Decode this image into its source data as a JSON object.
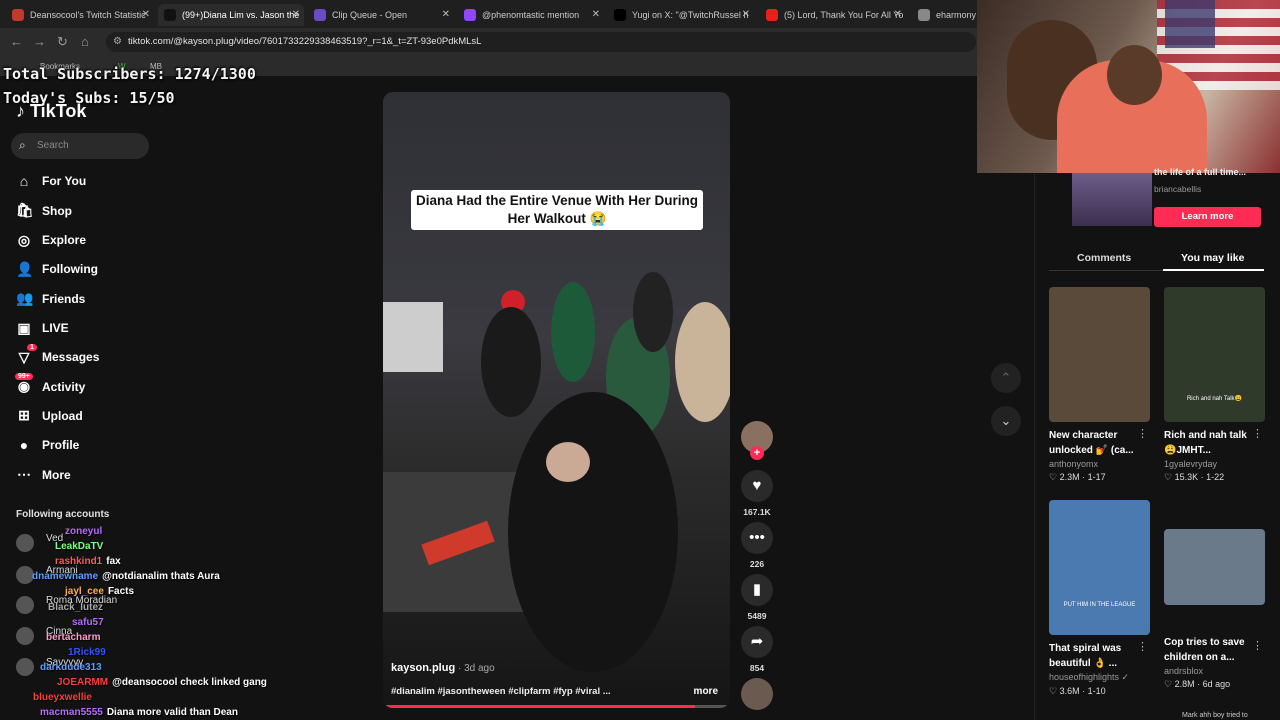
{
  "browser": {
    "tabs": [
      {
        "label": "Deansocool's Twitch Statistic",
        "color": "#c0392b"
      },
      {
        "label": "(99+)Diana Lim vs. Jason the",
        "color": "#111111",
        "active": true
      },
      {
        "label": "Clip Queue - Open",
        "color": "#6a4bc4"
      },
      {
        "label": "@phenomtastic mention",
        "color": "#9146ff"
      },
      {
        "label": "Yugi on X: \"@TwitchRussel h",
        "color": "#000000"
      },
      {
        "label": "(5) Lord, Thank You For All Yo",
        "color": "#e62117"
      },
      {
        "label": "eharmony -",
        "color": "#888888"
      }
    ],
    "url": "tiktok.com/@kayson.plug/video/7601733229338463519?_r=1&_t=ZT-93e0PdkMLsL",
    "bookmarks": [
      "Bookmarks",
      "W",
      "MB"
    ]
  },
  "overlay": {
    "subscribers": "Total Subscribers: 1274/1300",
    "today_subs": "Today's Subs: 15/50"
  },
  "tiktok": {
    "logo": "TikTok",
    "search_placeholder": "Search",
    "nav": [
      {
        "label": "For You",
        "icon": "home-icon"
      },
      {
        "label": "Shop",
        "icon": "shop-icon"
      },
      {
        "label": "Explore",
        "icon": "explore-icon"
      },
      {
        "label": "Following",
        "icon": "following-icon"
      },
      {
        "label": "Friends",
        "icon": "friends-icon"
      },
      {
        "label": "LIVE",
        "icon": "live-icon"
      },
      {
        "label": "Messages",
        "icon": "messages-icon",
        "badge": "1"
      },
      {
        "label": "Activity",
        "icon": "activity-icon",
        "badge": "99+"
      },
      {
        "label": "Upload",
        "icon": "upload-icon"
      },
      {
        "label": "Profile",
        "icon": "profile-icon"
      },
      {
        "label": "More",
        "icon": "more-icon"
      }
    ],
    "following_title": "Following accounts",
    "following_accounts": [
      "Ved",
      "Armani",
      "Roma Moradian",
      "Cinna",
      "Savvyyy"
    ]
  },
  "chat": [
    {
      "user": "zoneyul",
      "msg": "",
      "color": "#b56cff"
    },
    {
      "user": "LeakDaTV",
      "msg": "",
      "color": "#7fff7f"
    },
    {
      "user": "rashkind1",
      "msg": "fax",
      "color": "#ff5a5a"
    },
    {
      "user": "dnamewname",
      "msg": "@notdianalim thats Aura",
      "color": "#5aa0ff"
    },
    {
      "user": "jayl_cee",
      "msg": "Facts",
      "color": "#ffb347"
    },
    {
      "user": "Black_lutez",
      "msg": "",
      "color": "#aaaaaa"
    },
    {
      "user": "safu57",
      "msg": "",
      "color": "#b56cff"
    },
    {
      "user": "bertacharm",
      "msg": "",
      "color": "#ff9acb"
    },
    {
      "user": "1Rick99",
      "msg": "",
      "color": "#3355ff"
    },
    {
      "user": "darkdude313",
      "msg": "",
      "color": "#5aa0ff"
    },
    {
      "user": "JOEARMM",
      "msg": "@deansocool check linked gang",
      "color": "#ff3b3b"
    },
    {
      "user": "blueyxwellie",
      "msg": "",
      "color": "#ff3b3b"
    },
    {
      "user": "macman5555",
      "msg": "Diana more valid than Dean",
      "color": "#b56cff"
    }
  ],
  "video": {
    "caption": "Diana Had the Entire Venue With Her During Her Walkout 😭",
    "username": "kayson.plug",
    "date": " · 3d ago",
    "tags": "#dianalim #jasontheween #clipfarm #fyp #viral ...",
    "more": "more",
    "progress": 0.9,
    "likes": "167.1K",
    "comments": "226",
    "saves": "5489",
    "shares": "854"
  },
  "right_panel": {
    "ad_text": "the life of a full time...",
    "ad_account": "briancabellis",
    "learn_more": "Learn more",
    "tab_comments": "Comments",
    "tab_you_may_like": "You may like",
    "cards": [
      {
        "title": "New character\nunlocked 💅 (ca...",
        "author": "anthonyomx",
        "stats": "♡ 2.3M · 1-17",
        "thumb": "#5a4a3a"
      },
      {
        "title": "Rich and nah talk\n😩JMHT...",
        "author": "1gyalevryday",
        "stats": "♡ 15.3K · 1-22",
        "thumb": "#2f3a2a"
      },
      {
        "title": "That spiral was\nbeautiful 👌 ...",
        "author": "houseofhighlights ✓",
        "stats": "♡ 3.6M · 1-10",
        "thumb": "#4a7ab0"
      },
      {
        "title": "Cop tries to save\nchildren on a...",
        "author": "andrsblox",
        "stats": "♡ 2.8M · 6d ago",
        "thumb": "#6a7a8a"
      }
    ],
    "thumb_captions": [
      "Rich and nah Talk😩",
      "PUT HIM IN THE LEAGUE"
    ],
    "next_caption": "Mark ahh boy tried to"
  }
}
